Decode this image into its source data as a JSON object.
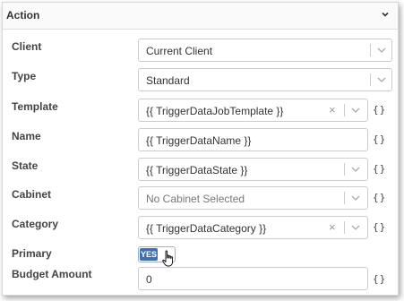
{
  "panel": {
    "title": "Action"
  },
  "fields": {
    "client": {
      "label": "Client",
      "value": "Current Client"
    },
    "type": {
      "label": "Type",
      "value": "Standard"
    },
    "template": {
      "label": "Template",
      "value": "{{ TriggerDataJobTemplate }}",
      "clear": "×",
      "braces": "{}"
    },
    "name": {
      "label": "Name",
      "value": "{{ TriggerDataName }}",
      "braces": "{}"
    },
    "state": {
      "label": "State",
      "value": "{{ TriggerDataState }}",
      "braces": "{}"
    },
    "cabinet": {
      "label": "Cabinet",
      "placeholder": "No Cabinet Selected",
      "braces": "{}"
    },
    "category": {
      "label": "Category",
      "value": "{{ TriggerDataCategory }}",
      "clear": "×",
      "braces": "{}"
    },
    "primary": {
      "label": "Primary",
      "toggle_on_label": "YES",
      "enabled": true
    },
    "budget": {
      "label": "Budget Amount",
      "value": "0",
      "braces": "{}"
    }
  },
  "icons": {
    "collapse": "chevron-down-icon",
    "dropdown": "chevron-down-icon",
    "clear": "clear-x-icon",
    "template_braces": "braces-icon",
    "cursor": "hand-pointer-icon"
  },
  "colors": {
    "accent": "#3e6fb2",
    "border": "#cccccc",
    "label": "#444444"
  }
}
